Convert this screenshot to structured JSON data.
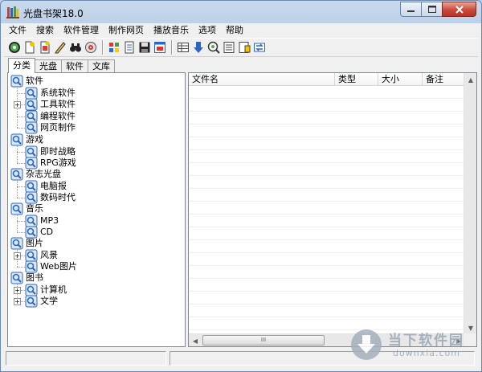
{
  "window": {
    "title": "光盘书架18.0"
  },
  "menu": [
    "文件",
    "搜索",
    "软件管理",
    "制作网页",
    "播放音乐",
    "选项",
    "帮助"
  ],
  "toolbar": {
    "group1": [
      "cd-icon",
      "new-doc-icon",
      "open-doc-icon",
      "edit-pencil-icon",
      "binoculars-icon",
      "scan-disc-icon"
    ],
    "group2": [
      "grid-color-icon",
      "document-list-icon",
      "save-floppy-icon",
      "window-app-icon"
    ],
    "group3": [
      "table-icon",
      "download-arrow-icon",
      "search-disc-icon",
      "checklist-icon",
      "help-note-icon",
      "refresh-swap-icon"
    ]
  },
  "tabs": [
    "分类",
    "光盘",
    "软件",
    "文库"
  ],
  "tree": {
    "software": {
      "label": "软件",
      "children": [
        "系统软件",
        "工具软件",
        "编程软件",
        "网页制作"
      ]
    },
    "games": {
      "label": "游戏",
      "children": [
        "即时战略",
        "RPG游戏"
      ]
    },
    "magazines": {
      "label": "杂志光盘",
      "children": [
        "电脑报",
        "数码时代"
      ]
    },
    "music": {
      "label": "音乐",
      "children": [
        "MP3",
        "CD"
      ]
    },
    "pictures": {
      "label": "图片",
      "children": [
        "风景",
        "Web图片"
      ]
    },
    "books": {
      "label": "图书",
      "children": [
        "计算机",
        "文学"
      ]
    }
  },
  "list": {
    "columns": [
      "文件名",
      "类型",
      "大小",
      "备注"
    ],
    "scroll_grip": "III"
  },
  "watermark": {
    "title": "当下软件园",
    "url": "downxia.com"
  },
  "colors": {
    "close_button": "#c9483a",
    "titlebar": "#c9daee",
    "tree_icon_blue": "#2b66c4"
  }
}
